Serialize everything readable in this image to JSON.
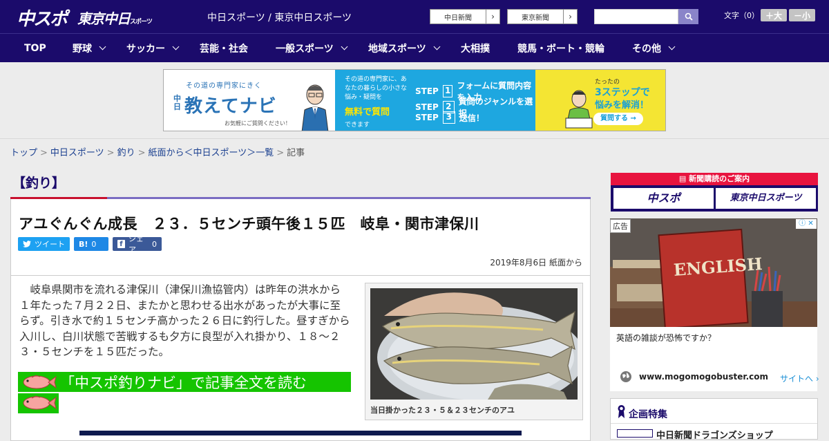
{
  "header": {
    "logo_main": "中スポ",
    "logo_tokyo": "東京中日",
    "logo_tokyo_small": "スポーツ",
    "site_names": "中日スポーツ / 東京中日スポーツ",
    "ext_links": [
      {
        "label": "中日新聞"
      },
      {
        "label": "東京新聞"
      }
    ],
    "search": {
      "placeholder": ""
    },
    "font_size": {
      "label": "文字（0）",
      "larger": "＋大",
      "smaller": "－小"
    }
  },
  "nav": {
    "items": [
      {
        "label": "TOP",
        "dropdown": false
      },
      {
        "label": "野球",
        "dropdown": true
      },
      {
        "label": "サッカー",
        "dropdown": true
      },
      {
        "label": "芸能・社会",
        "dropdown": false
      },
      {
        "label": "一般スポーツ",
        "dropdown": true
      },
      {
        "label": "地域スポーツ",
        "dropdown": true
      },
      {
        "label": "大相撲",
        "dropdown": false
      },
      {
        "label": "競馬・ボート・競輪",
        "dropdown": false
      },
      {
        "label": "その他",
        "dropdown": true
      }
    ]
  },
  "banner": {
    "tagline": "その道の専門家にきく",
    "brand_prefix": "中日",
    "brand": "教えてナビ",
    "sub": "お気軽にご質問ください！",
    "intro": "その道の専門家に、あなたの暮らしの小さな悩み・疑問を",
    "free": "無料で質問",
    "dekimasu": "できます",
    "steps": [
      {
        "word": "STEP",
        "num": "1",
        "text": "フォームに質問内容を入力"
      },
      {
        "word": "STEP",
        "num": "2",
        "text": "質問のジャンルを選択"
      },
      {
        "word": "STEP",
        "num": "3",
        "text": "送信！"
      }
    ],
    "tatta": "たったの",
    "three_step": "3ステップで",
    "kaiketsu": "悩みを解消！",
    "ask_button": "質問する →"
  },
  "breadcrumb": [
    "トップ",
    "中日スポーツ",
    "釣り",
    "紙面から＜中日スポーツ＞一覧",
    "記事"
  ],
  "article": {
    "category": "【釣り】",
    "headline": "アユぐんぐん成長　２３．５センチ頭午後１５匹　岐阜・関市津保川",
    "share": {
      "tweet": "ツイート",
      "hatena_count": "0",
      "facebook": "シェア",
      "facebook_count": "0"
    },
    "date": "2019年8月6日 紙面から",
    "body": "岐阜県関市を流れる津保川（津保川漁協管内）は昨年の洪水から１年たった７月２２日、またかと思わせる出水があったが大事に至らず。引き水で約１５センチ高かった２６日に釣行した。昼すぎから入川し、白川状態で苦戦するも夕方に良型が入れ掛かり、１８～２３・５センチを１５匹だった。",
    "readmore": "「中スポ釣りナビ」で記事全文を読む",
    "photo_caption": "当日掛かった２３・５＆２３センチのアユ"
  },
  "sidebar": {
    "subscribe": {
      "heading": "新聞購読のご案内",
      "chuspo": "中スポ",
      "tokyo": "東京中日スポーツ"
    },
    "ad": {
      "label": "広告",
      "question": "英語の雑談が恐怖ですか？",
      "url": "www.mogomogobuster.com",
      "site_link": "サイトへ",
      "book_text": "ENGLISH"
    },
    "kikaku": {
      "title": "企画特集",
      "item": "中日新聞ドラゴンズショップ"
    }
  },
  "colors": {
    "header_bg": "#1b0b6b",
    "accent_red": "#c8102e",
    "accent_purple": "#7a6cc2",
    "readmore_green": "#15c400"
  }
}
